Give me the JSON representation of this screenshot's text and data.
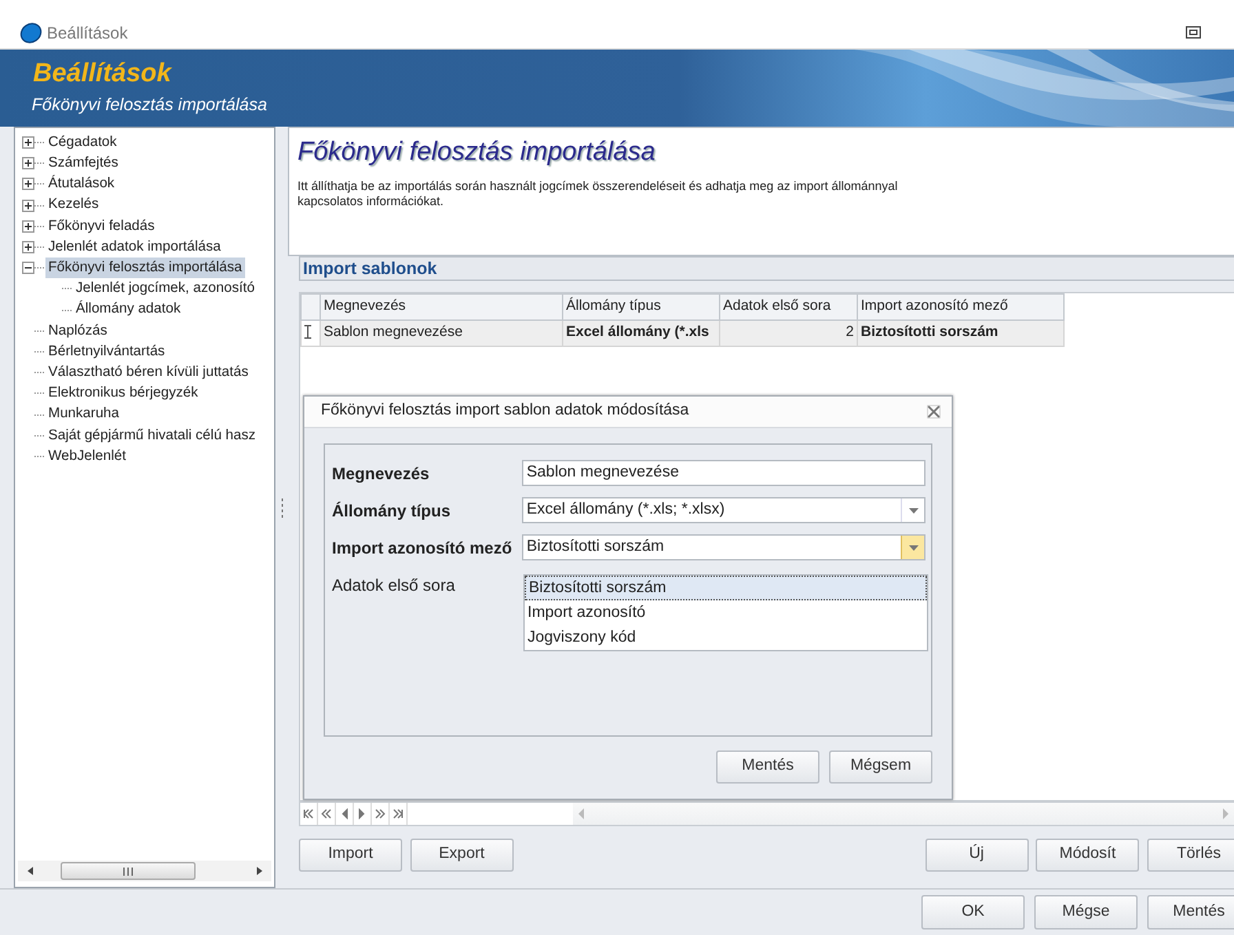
{
  "window": {
    "title": "Beállítások"
  },
  "banner": {
    "title": "Beállítások",
    "subtitle": "Főkönyvi felosztás importálása"
  },
  "tree": [
    {
      "label": "Cégadatok",
      "expanded": false,
      "selected": false
    },
    {
      "label": "Számfejtés",
      "expanded": false,
      "selected": false
    },
    {
      "label": "Átutalások",
      "expanded": false,
      "selected": false
    },
    {
      "label": "Kezelés",
      "expanded": false,
      "selected": false
    },
    {
      "label": "Főkönyvi feladás",
      "expanded": false,
      "selected": false
    },
    {
      "label": "Jelenlét adatok importálása",
      "expanded": false,
      "selected": false
    },
    {
      "label": "Főkönyvi felosztás importálása",
      "expanded": true,
      "selected": true,
      "children": [
        {
          "label": "Jelenlét jogcímek, azonosító",
          "selected": false
        },
        {
          "label": "Állomány adatok",
          "selected": false
        }
      ]
    },
    {
      "label": "Naplózás",
      "selected": false
    },
    {
      "label": "Bérletnyilvántartás",
      "selected": false
    },
    {
      "label": "Választható béren kívüli juttatás",
      "selected": false
    },
    {
      "label": "Elektronikus bérjegyzék",
      "selected": false
    },
    {
      "label": "Munkaruha",
      "selected": false
    },
    {
      "label": "Saját gépjármű hivatali célú hasz",
      "selected": false
    },
    {
      "label": "WebJelenlét",
      "selected": false
    }
  ],
  "page": {
    "title": "Főkönyvi felosztás importálása",
    "description": "Itt állíthatja be az importálás során használt jogcímek összerendeléseit és adhatja meg az import állománnyal kapcsolatos információkat."
  },
  "group": {
    "title": "Import sablonok"
  },
  "grid": {
    "columns": [
      "Megnevezés",
      "Állomány típus",
      "Adatok első sora",
      "Import azonosító mező"
    ],
    "rows": [
      {
        "editing": true,
        "cells": [
          {
            "text": "Sablon megnevezése",
            "bold": false
          },
          {
            "text": "Excel állomány (*.xls",
            "bold": true
          },
          {
            "text": "2",
            "bold": false
          },
          {
            "text": "Biztosítotti sorszám",
            "bold": true
          }
        ]
      }
    ]
  },
  "dialog": {
    "title": "Főkönyvi felosztás import sablon adatok módosítása",
    "fields": [
      {
        "kind": "text",
        "label": "Megnevezés",
        "bold": true,
        "value": "Sablon megnevezése"
      },
      {
        "kind": "combo",
        "label": "Állomány típus",
        "bold": true,
        "value": "Excel állomány (*.xls; *.xlsx)",
        "open": false
      },
      {
        "kind": "combo",
        "label": "Import azonosító mező",
        "bold": true,
        "value": "Biztosítotti sorszám",
        "open": true,
        "options": [
          {
            "label": "Biztosítotti sorszám",
            "selected": true
          },
          {
            "label": "Import azonosító",
            "selected": false
          },
          {
            "label": "Jogviszony kód",
            "selected": false
          }
        ]
      },
      {
        "kind": "none",
        "label": "Adatok első sora",
        "bold": false
      }
    ],
    "buttons": [
      "Mentés",
      "Mégsem"
    ]
  },
  "grid_buttons_left": [
    "Import",
    "Export"
  ],
  "grid_buttons_right": [
    "Új",
    "Módosít",
    "Törlés"
  ],
  "footer_buttons": [
    "OK",
    "Mégse",
    "Mentés"
  ]
}
